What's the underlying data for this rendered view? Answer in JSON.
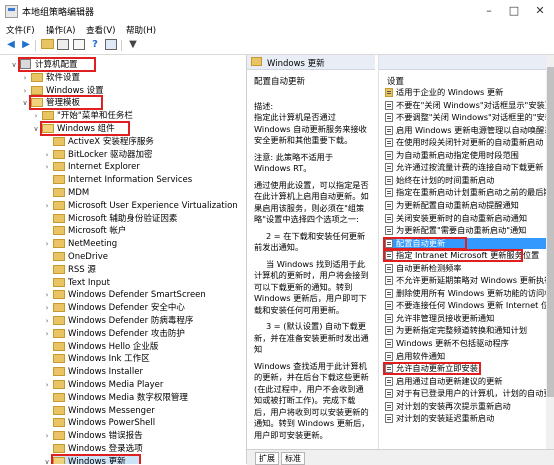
{
  "window": {
    "title": "本地组策略编辑器"
  },
  "menu": [
    "文件(F)",
    "操作(A)",
    "查看(V)",
    "帮助(H)"
  ],
  "tree": [
    {
      "label": "计算机配置",
      "level": 0,
      "twisty": "down",
      "icon": "computer",
      "boxed": true
    },
    {
      "label": "软件设置",
      "level": 1,
      "twisty": "right",
      "icon": "folder"
    },
    {
      "label": "Windows 设置",
      "level": 1,
      "twisty": "right",
      "icon": "folder"
    },
    {
      "label": "管理模板",
      "level": 1,
      "twisty": "down",
      "icon": "folder",
      "boxed": true
    },
    {
      "label": "\"开始\"菜单和任务栏",
      "level": 2,
      "twisty": "right",
      "icon": "folder"
    },
    {
      "label": "Windows 组件",
      "level": 2,
      "twisty": "down",
      "icon": "folder",
      "boxed": true
    },
    {
      "label": "ActiveX 安装程序服务",
      "level": 3,
      "twisty": "",
      "icon": "folder"
    },
    {
      "label": "BitLocker 驱动器加密",
      "level": 3,
      "twisty": "right",
      "icon": "folder"
    },
    {
      "label": "Internet Explorer",
      "level": 3,
      "twisty": "right",
      "icon": "folder"
    },
    {
      "label": "Internet Information Services",
      "level": 3,
      "twisty": "",
      "icon": "folder"
    },
    {
      "label": "MDM",
      "level": 3,
      "twisty": "",
      "icon": "folder"
    },
    {
      "label": "Microsoft User Experience Virtualization",
      "level": 3,
      "twisty": "right",
      "icon": "folder"
    },
    {
      "label": "Microsoft 辅助身份验证因素",
      "level": 3,
      "twisty": "",
      "icon": "folder"
    },
    {
      "label": "Microsoft 帐户",
      "level": 3,
      "twisty": "",
      "icon": "folder"
    },
    {
      "label": "NetMeeting",
      "level": 3,
      "twisty": "right",
      "icon": "folder"
    },
    {
      "label": "OneDrive",
      "level": 3,
      "twisty": "",
      "icon": "folder"
    },
    {
      "label": "RSS 源",
      "level": 3,
      "twisty": "",
      "icon": "folder"
    },
    {
      "label": "Text Input",
      "level": 3,
      "twisty": "",
      "icon": "folder"
    },
    {
      "label": "Windows Defender SmartScreen",
      "level": 3,
      "twisty": "right",
      "icon": "folder"
    },
    {
      "label": "Windows Defender 安全中心",
      "level": 3,
      "twisty": "right",
      "icon": "folder"
    },
    {
      "label": "Windows Defender 防病毒程序",
      "level": 3,
      "twisty": "right",
      "icon": "folder"
    },
    {
      "label": "Windows Defender 攻击防护",
      "level": 3,
      "twisty": "right",
      "icon": "folder"
    },
    {
      "label": "Windows Hello 企业版",
      "level": 3,
      "twisty": "",
      "icon": "folder"
    },
    {
      "label": "Windows Ink 工作区",
      "level": 3,
      "twisty": "",
      "icon": "folder"
    },
    {
      "label": "Windows Installer",
      "level": 3,
      "twisty": "",
      "icon": "folder"
    },
    {
      "label": "Windows Media Player",
      "level": 3,
      "twisty": "right",
      "icon": "folder"
    },
    {
      "label": "Windows Media 数字权限管理",
      "level": 3,
      "twisty": "",
      "icon": "folder"
    },
    {
      "label": "Windows Messenger",
      "level": 3,
      "twisty": "",
      "icon": "folder"
    },
    {
      "label": "Windows PowerShell",
      "level": 3,
      "twisty": "",
      "icon": "folder"
    },
    {
      "label": "Windows 错误报告",
      "level": 3,
      "twisty": "right",
      "icon": "folder"
    },
    {
      "label": "Windows 登录选项",
      "level": 3,
      "twisty": "",
      "icon": "folder"
    },
    {
      "label": "Windows 更新",
      "level": 3,
      "twisty": "down",
      "icon": "folder",
      "boxed": true,
      "selected": true
    }
  ],
  "middle": {
    "header": "Windows 更新",
    "heading": "配置自动更新",
    "paragraphs": [
      "描述:",
      "指定此计算机是否通过 Windows 自动更新服务来接收安全更新和其他重要下载。",
      "注意: 此策略不适用于 Windows RT。",
      "通过使用此设置，可以指定是否在此计算机上启用自动更新。如果启用该服务，则必须在\"组策略\"设置中选择四个选项之一:",
      "2 = 在下载和安装任何更新前发出通知。",
      "当 Windows 找到适用于此计算机的更新时，用户将会接到可以下载更新的通知。转到 Windows 更新后，用户即可下载和安装任何可用更新。",
      "3 = (默认设置) 自动下载更新，并在准备安装更新时发出通知",
      "Windows 查找适用于此计算机的更新，并在后台下载这些更新(在此过程中，用户不会收到通知或被打断工作)。完成下载后，用户将收到可以安装更新的通知。转到 Windows 更新后，用户即可安装更新。"
    ]
  },
  "right": {
    "column_header": "设置",
    "settings": [
      "适用于企业的 Windows 更新",
      "不要在\"关闭 Windows\"对话框显示\"安装更新",
      "不要调整\"关闭 Windows\"对话框里的\"安装更",
      "启用 Windows 更新电源管理以自动唤醒系统",
      "在使用时段关闭针对更新的自动重新启动",
      "为自动重新启动指定使用时段范围",
      "允许通过按流量计费的连接自动下载更新",
      "始终在计划的时间重新启动",
      "指定在重新启动计划重新启动之前的最后期限",
      "为更新配置自动重新启动提醒通知",
      "关闭安装更新时的自动重新启动通知",
      "为更新配置\"需要自动重新启动\"通知",
      "配置自动更新",
      "指定 Intranet Microsoft 更新服务位置",
      "自动更新检测频率",
      "不允许更新延期策略对 Windows 更新执行扫",
      "删除使用所有 Windows 更新功能的访问权限",
      "不要连接任何 Windows 更新 Internet 位置",
      "允许非管理员接收更新通知",
      "为更新指定完整频道转换和通知计划",
      "Windows 更新不包括驱动程序",
      "启用软件通知",
      "允许自动更新立即安装",
      "启用通过自动更新建议的更新",
      "对于有已登录用户的计算机，计划的自动更新",
      "对计划的安装再次提示重新启动",
      "对计划的安装延迟重新启动"
    ],
    "selected_index": 12,
    "boxed": [
      12,
      13,
      22
    ]
  },
  "tabs": [
    "扩展",
    "标准"
  ]
}
